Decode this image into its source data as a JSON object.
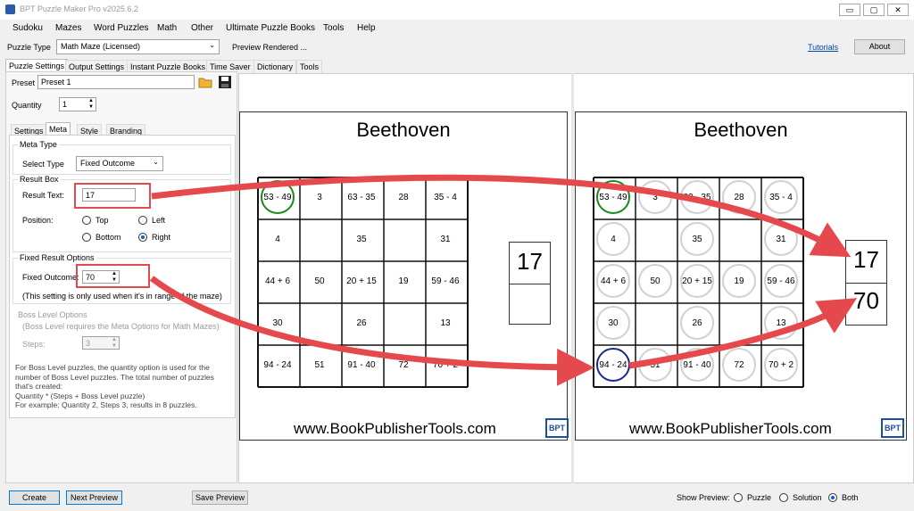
{
  "window": {
    "title": "BPT Puzzle Maker Pro v2025.6.2",
    "controls": [
      "▭",
      "▢",
      "✕"
    ]
  },
  "menu": [
    "Sudoku",
    "Mazes",
    "Word Puzzles",
    "Math",
    "Other",
    "Ultimate Puzzle Books",
    "Tools",
    "Help"
  ],
  "toolbar": {
    "puzzle_type_label": "Puzzle Type",
    "puzzle_type_value": "Math Maze (Licensed)",
    "status": "Preview Rendered ...",
    "tutorials_link": "Tutorials",
    "about_button": "About"
  },
  "main_tabs": [
    "Puzzle Settings",
    "Output Settings",
    "Instant Puzzle Books",
    "Time Saver",
    "Dictionary",
    "Tools"
  ],
  "preset": {
    "label": "Preset",
    "value": "Preset 1"
  },
  "quantity": {
    "label": "Quantity",
    "value": "1"
  },
  "sub_tabs": [
    "Settings",
    "Meta",
    "Style",
    "Branding"
  ],
  "meta": {
    "meta_type_group": "Meta Type",
    "select_type_label": "Select Type",
    "select_type_value": "Fixed Outcome",
    "result_box_group": "Result Box",
    "result_text_label": "Result Text:",
    "result_text_value": "17",
    "position_label": "Position:",
    "pos_top": "Top",
    "pos_left": "Left",
    "pos_bottom": "Bottom",
    "pos_right": "Right",
    "fixed_group": "Fixed Result Options",
    "fixed_outcome_label": "Fixed Outcome:",
    "fixed_outcome_value": "70",
    "fixed_note": "(This setting is only used when it's in range of the maze)",
    "boss_group": "Boss Level Options",
    "boss_note": "(Boss Level requires the Meta Options for Math Mazes)",
    "steps_label": "Steps:",
    "steps_value": "3",
    "boss_help_1": "For Boss Level puzzles, the quantity option is used for the",
    "boss_help_2": "number of Boss Level puzzles. The total number of puzzles",
    "boss_help_3": "that's created:",
    "boss_help_4": "Quantity * (Steps + Boss Level puzzle)",
    "boss_help_5": "For example: Quantity 2, Steps 3, results in 8 puzzles."
  },
  "bottom": {
    "create": "Create",
    "next_preview": "Next Preview",
    "save_preview": "Save Preview",
    "show_preview_label": "Show Preview:",
    "opt_puzzle": "Puzzle",
    "opt_solution": "Solution",
    "opt_both": "Both"
  },
  "puzzle": {
    "title": "Beethoven",
    "url": "www.BookPublisherTools.com",
    "logo": "BPT",
    "cells": [
      [
        "53 - 49",
        "3",
        "63 - 35",
        "28",
        "35 - 4"
      ],
      [
        "4",
        "",
        "35",
        "",
        "31"
      ],
      [
        "44 + 6",
        "50",
        "20 + 15",
        "19",
        "59 - 46"
      ],
      [
        "30",
        "",
        "26",
        "",
        "13"
      ],
      [
        "94 - 24",
        "51",
        "91 - 40",
        "72",
        "70 + 2"
      ]
    ],
    "result_top": "17",
    "result_bottom_solution": "70"
  },
  "colors": {
    "accent": "#0078d7",
    "highlight": "#e5484d",
    "start": "#1a8a1a",
    "end": "#1a2a8a"
  }
}
